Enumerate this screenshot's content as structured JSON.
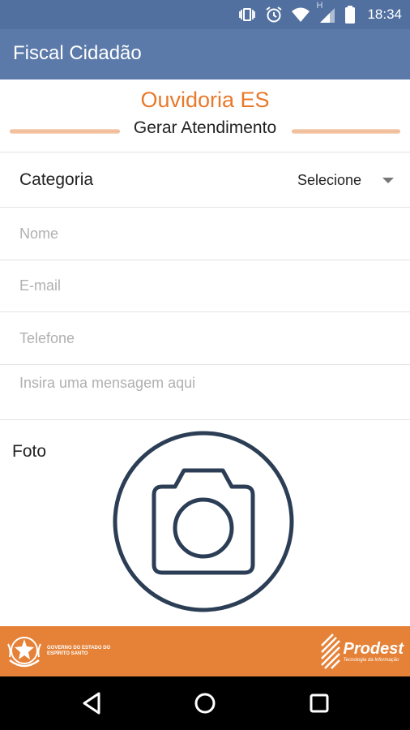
{
  "status_bar": {
    "time": "18:34",
    "network_label": "H",
    "icons": [
      "vibrate-icon",
      "alarm-icon",
      "wifi-icon",
      "signal-icon",
      "battery-icon"
    ]
  },
  "app_bar": {
    "title": "Fiscal Cidadão"
  },
  "header": {
    "title": "Ouvidoria ES",
    "subtitle": "Gerar Atendimento"
  },
  "form": {
    "category": {
      "label": "Categoria",
      "selected": "Selecione"
    },
    "nome_placeholder": "Nome",
    "email_placeholder": "E-mail",
    "telefone_placeholder": "Telefone",
    "message_placeholder": "Insira uma mensagem aqui",
    "photo_label": "Foto"
  },
  "footer": {
    "gov_text": "GOVERNO DO ESTADO DO ESPÍRITO SANTO",
    "prodest_name": "Prodest",
    "prodest_tagline": "Tecnologia da Informação"
  },
  "nav": {
    "icons": [
      "back-icon",
      "home-icon",
      "recent-apps-icon"
    ]
  },
  "colors": {
    "status_bar": "#5170a0",
    "app_bar": "#5b7aa9",
    "accent_orange": "#e8792b",
    "footer_orange": "#e58238",
    "camera_stroke": "#2c3e55"
  }
}
